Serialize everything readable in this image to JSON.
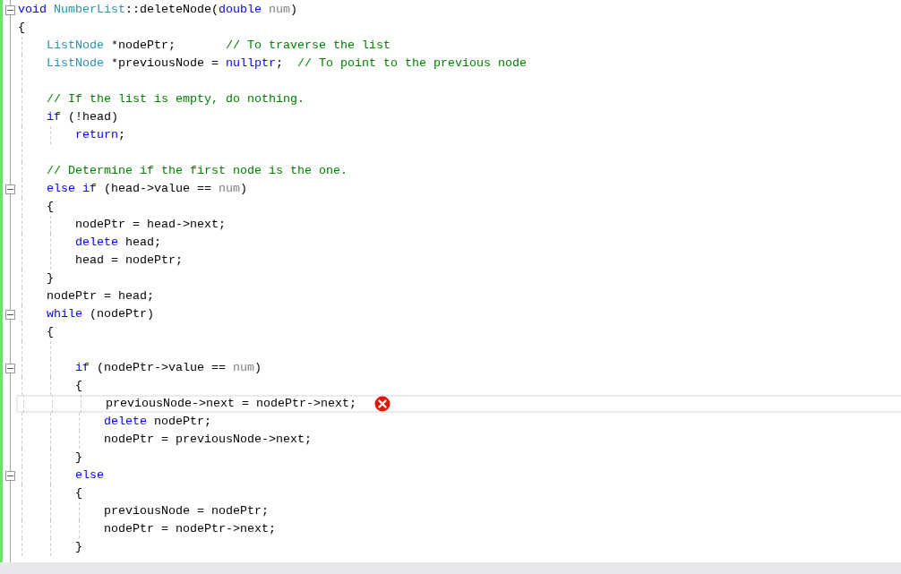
{
  "editor": {
    "lines": [
      {
        "kind": "code",
        "expanded": true,
        "tokens": [
          {
            "kind": "keyword",
            "text": "void"
          },
          {
            "kind": "type",
            "text": " NumberList"
          },
          {
            "kind": "plain",
            "text": "::deleteNode("
          },
          {
            "kind": "keyword",
            "text": "double"
          },
          {
            "kind": "param",
            "text": " num"
          },
          {
            "kind": "plain",
            "text": ")"
          }
        ]
      },
      {
        "kind": "code",
        "tokens": [
          {
            "kind": "plain",
            "text": "{"
          }
        ],
        "children": [
          {
            "kind": "code",
            "tokens": [
              {
                "kind": "type",
                "text": "ListNode"
              },
              {
                "kind": "plain",
                "text": " *nodePtr;       "
              },
              {
                "kind": "comment",
                "text": "// To traverse the list"
              }
            ]
          },
          {
            "kind": "code",
            "tokens": [
              {
                "kind": "type",
                "text": "ListNode"
              },
              {
                "kind": "plain",
                "text": " *previousNode = "
              },
              {
                "kind": "keyword",
                "text": "nullptr"
              },
              {
                "kind": "plain",
                "text": ";  "
              },
              {
                "kind": "comment",
                "text": "// To point to the previous node"
              }
            ]
          },
          {
            "kind": "blank"
          },
          {
            "kind": "code",
            "tokens": [
              {
                "kind": "comment",
                "text": "// If the list is empty, do nothing."
              }
            ]
          },
          {
            "kind": "code",
            "tokens": [
              {
                "kind": "keyword",
                "text": "if"
              },
              {
                "kind": "plain",
                "text": " (!head)"
              }
            ],
            "children": [
              {
                "kind": "code",
                "tokens": [
                  {
                    "kind": "keyword",
                    "text": "return"
                  },
                  {
                    "kind": "plain",
                    "text": ";"
                  }
                ]
              }
            ]
          },
          {
            "kind": "blank"
          },
          {
            "kind": "code",
            "tokens": [
              {
                "kind": "comment",
                "text": "// Determine if the first node is the one."
              }
            ]
          },
          {
            "kind": "code",
            "expanded": true,
            "tokens": [
              {
                "kind": "keyword",
                "text": "else"
              },
              {
                "kind": "keyword",
                "text": " if"
              },
              {
                "kind": "plain",
                "text": " (head->value == "
              },
              {
                "kind": "param",
                "text": "num"
              },
              {
                "kind": "plain",
                "text": ")"
              }
            ]
          },
          {
            "kind": "code",
            "tokens": [
              {
                "kind": "plain",
                "text": "{"
              }
            ],
            "children": [
              {
                "kind": "code",
                "tokens": [
                  {
                    "kind": "plain",
                    "text": "nodePtr = head->next;"
                  }
                ]
              },
              {
                "kind": "code",
                "tokens": [
                  {
                    "kind": "keyword",
                    "text": "delete"
                  },
                  {
                    "kind": "plain",
                    "text": " head;"
                  }
                ]
              },
              {
                "kind": "code",
                "tokens": [
                  {
                    "kind": "plain",
                    "text": "head = nodePtr;"
                  }
                ]
              }
            ]
          },
          {
            "kind": "code",
            "tokens": [
              {
                "kind": "plain",
                "text": "}"
              }
            ]
          },
          {
            "kind": "code",
            "tokens": [
              {
                "kind": "plain",
                "text": "nodePtr = head;"
              }
            ]
          },
          {
            "kind": "code",
            "expanded": true,
            "tokens": [
              {
                "kind": "keyword",
                "text": "while"
              },
              {
                "kind": "plain",
                "text": " (nodePtr)"
              }
            ]
          },
          {
            "kind": "code",
            "tokens": [
              {
                "kind": "plain",
                "text": "{"
              }
            ],
            "children": [
              {
                "kind": "blank"
              },
              {
                "kind": "code",
                "expanded": true,
                "tokens": [
                  {
                    "kind": "keyword",
                    "text": "if"
                  },
                  {
                    "kind": "plain",
                    "text": " (nodePtr->value == "
                  },
                  {
                    "kind": "param",
                    "text": "num"
                  },
                  {
                    "kind": "plain",
                    "text": ")"
                  }
                ]
              },
              {
                "kind": "code",
                "tokens": [
                  {
                    "kind": "plain",
                    "text": "{"
                  }
                ],
                "children": [
                  {
                    "kind": "code",
                    "current": true,
                    "error": true,
                    "tokens": [
                      {
                        "kind": "plain",
                        "text": "previousNode->next = nodePtr->next;"
                      }
                    ]
                  },
                  {
                    "kind": "code",
                    "tokens": [
                      {
                        "kind": "keyword",
                        "text": "delete"
                      },
                      {
                        "kind": "plain",
                        "text": " nodePtr;"
                      }
                    ]
                  },
                  {
                    "kind": "code",
                    "tokens": [
                      {
                        "kind": "plain",
                        "text": "nodePtr = previousNode->next;"
                      }
                    ]
                  }
                ]
              },
              {
                "kind": "code",
                "tokens": [
                  {
                    "kind": "plain",
                    "text": "}"
                  }
                ]
              },
              {
                "kind": "code",
                "expanded": true,
                "tokens": [
                  {
                    "kind": "keyword",
                    "text": "else"
                  }
                ]
              },
              {
                "kind": "code",
                "tokens": [
                  {
                    "kind": "plain",
                    "text": "{"
                  }
                ],
                "children": [
                  {
                    "kind": "code",
                    "tokens": [
                      {
                        "kind": "plain",
                        "text": "previousNode = nodePtr;"
                      }
                    ]
                  },
                  {
                    "kind": "code",
                    "tokens": [
                      {
                        "kind": "plain",
                        "text": "nodePtr = nodePtr->next;"
                      }
                    ]
                  }
                ]
              },
              {
                "kind": "code",
                "tokens": [
                  {
                    "kind": "plain",
                    "text": "}"
                  }
                ]
              }
            ]
          }
        ]
      }
    ]
  }
}
